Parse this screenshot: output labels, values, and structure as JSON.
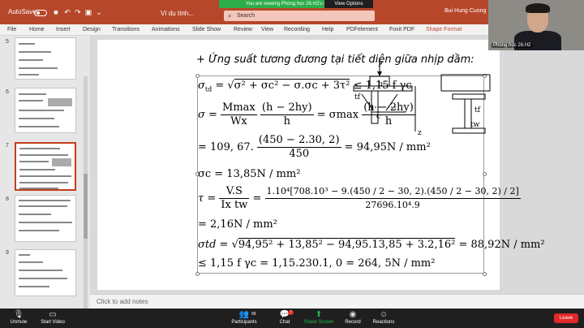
{
  "titlebar": {
    "autosave": "AutoSave",
    "file_name": "Ví dụ tính...",
    "search_placeholder": "Search",
    "zoom_banner": "You are viewing Phòng học 26.H2's screen",
    "view_options": "View Options",
    "user": "Bui Hung Cuong"
  },
  "ribbon": {
    "tabs": [
      "File",
      "Home",
      "Insert",
      "Design",
      "Transitions",
      "Animations",
      "Slide Show",
      "Review",
      "View",
      "Recording",
      "Help",
      "PDFelement",
      "Foxit PDF",
      "Shape Format"
    ]
  },
  "thumbnails": {
    "numbers": [
      "5",
      "6",
      "7",
      "8",
      "9"
    ],
    "active": "7"
  },
  "slide": {
    "headline": "+ Ứng suất tương đương tại tiết diện giữa nhịp dầm:",
    "eq1_lhs": "σ",
    "eq1_sub": "td",
    "eq1_root": "σ² + σc² − σ.σc + 3τ²",
    "eq1_rhs": "≤ 1,15 f γc",
    "eq2_lhs": "σ =",
    "eq2_num1": "Mmax",
    "eq2_den1": "Wx",
    "eq2_num2": "(h − 2hy)",
    "eq2_den2": "h",
    "eq2_mid": "= σmax",
    "eq2_num3": "(h − 2hy)",
    "eq2_den3": "h",
    "eq3_lhs": "= 109, 67.",
    "eq3_num": "(450 − 2.30, 2)",
    "eq3_den": "450",
    "eq3_rhs": "= 94,95N / mm²",
    "eq4": "σc = 13,85N / mm²",
    "eq5_lhs": "τ =",
    "eq5_num1": "V.S",
    "eq5_den1": "Ix tw",
    "eq5_mid": "=",
    "eq5_num2": "1.10⁴[708.10³ − 9.(450 / 2 − 30, 2).(450 / 2 − 30, 2) / 2]",
    "eq5_den2": "27696.10⁴.9",
    "eq6": "= 2,16N / mm²",
    "eq7_lhs": "σtd =",
    "eq7_root": "94,95² + 13,85² − 94,95.13,85 + 3.2,16²",
    "eq7_rhs": "= 88,92N / mm²",
    "eq8": "≤ 1,15 f γc = 1,15.230.1, 0 = 264, 5N / mm²",
    "diagram_labels": {
      "F": "F",
      "b": "b",
      "tf": "tf",
      "c": "c",
      "z": "z",
      "tf2": "tf",
      "tw": "tw"
    }
  },
  "notes": {
    "placeholder": "Click to add notes"
  },
  "webcam": {
    "label": "Phòng học 26.H2"
  },
  "zoombar": {
    "unmute": "Unmute",
    "start_video": "Start Video",
    "participants": "Participants",
    "participants_count": "99",
    "chat": "Chat",
    "chat_badge": "7",
    "share_screen": "Share Screen",
    "record": "Record",
    "reactions": "Reactions",
    "leave": "Leave"
  }
}
